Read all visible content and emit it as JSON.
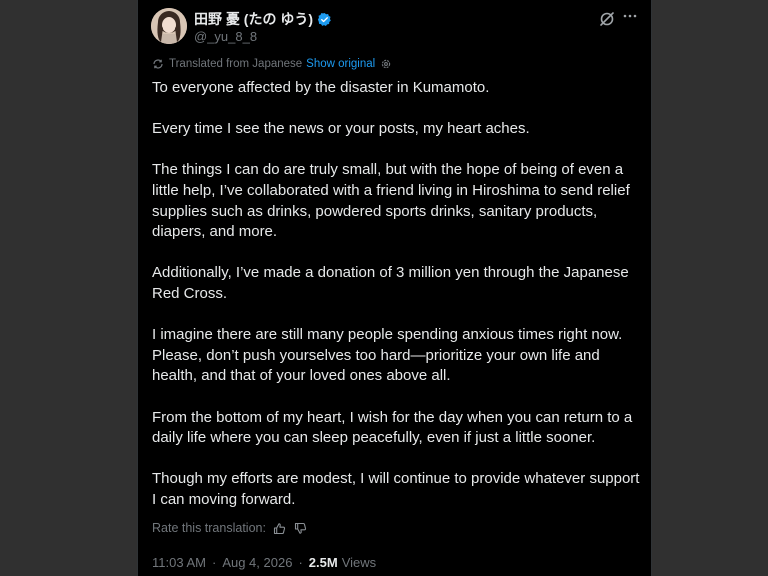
{
  "author": {
    "display_name": "田野 憂 (たの ゆう)",
    "handle": "@_yu_8_8"
  },
  "translation": {
    "notice": "Translated from Japanese",
    "show_original": "Show original",
    "rate_label": "Rate this translation:"
  },
  "paragraphs": [
    "To everyone affected by the disaster in Kumamoto.",
    "Every time I see the news or your posts, my heart aches.",
    "The things I can do are truly small, but with the hope of being of even a little help, I’ve collaborated with a friend living in Hiroshima to send relief supplies such as drinks, powdered sports drinks, sanitary products, diapers, and more.",
    "Additionally, I’ve made a donation of 3 million yen through the Japanese Red Cross.",
    "I imagine there are still many people spending anxious times right now. Please, don’t push yourselves too hard—prioritize your own life and health, and that of your loved ones above all.",
    "From the bottom of my heart, I wish for the day when you can return to a daily life where you can sleep peacefully, even if just a little sooner.",
    "Though my efforts are modest, I will continue to provide whatever support I can moving forward."
  ],
  "meta": {
    "time": "11:03 AM",
    "separator": "·",
    "date": "Aug 4, 2026",
    "views_count": "2.5M",
    "views_label": "Views"
  },
  "colors": {
    "background": "#000000",
    "text": "#e7e9ea",
    "secondary": "#71767b",
    "link": "#1d9bf0",
    "verified": "#1d9bf0"
  },
  "icons": [
    "verified-badge-icon",
    "grok-icon",
    "more-icon",
    "translate-icon",
    "gear-icon",
    "thumbs-up-icon",
    "thumbs-down-icon"
  ]
}
